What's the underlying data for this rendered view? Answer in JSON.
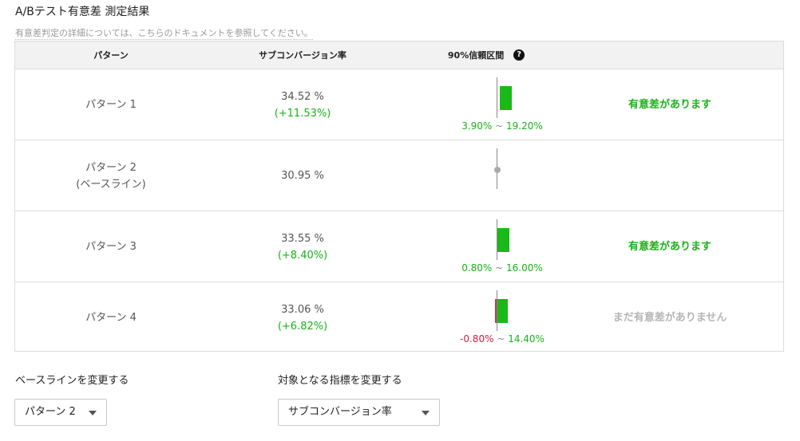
{
  "page": {
    "title": "A/Bテスト有意差 測定結果",
    "subtitle": "有意差判定の詳細については、こちらのドキュメントを参照してください。"
  },
  "table": {
    "headers": {
      "pattern": "パターン",
      "rate": "サブコンバージョン率",
      "ci": "90%信頼区間",
      "help_icon_glyph": "?"
    },
    "rows": [
      {
        "name": "パターン 1",
        "name_sub": "",
        "rate": "34.52 %",
        "lift": "(+11.53%)",
        "ci_low": "3.90%",
        "ci_sep": "~",
        "ci_high": "19.20%",
        "ci_low_value": 3.9,
        "ci_high_value": 19.2,
        "verdict": "有意差があります",
        "verdict_status": "significant"
      },
      {
        "name": "パターン 2",
        "name_sub": "(ベースライン)",
        "rate": "30.95 %",
        "lift": "",
        "ci_low": "",
        "ci_sep": "",
        "ci_high": "",
        "verdict": "",
        "verdict_status": "baseline"
      },
      {
        "name": "パターン 3",
        "name_sub": "",
        "rate": "33.55 %",
        "lift": "(+8.40%)",
        "ci_low": "0.80%",
        "ci_sep": "~",
        "ci_high": "16.00%",
        "ci_low_value": 0.8,
        "ci_high_value": 16.0,
        "verdict": "有意差があります",
        "verdict_status": "significant"
      },
      {
        "name": "パターン 4",
        "name_sub": "",
        "rate": "33.06 %",
        "lift": "(+6.82%)",
        "ci_low": "-0.80%",
        "ci_sep": "~",
        "ci_high": "14.40%",
        "ci_low_value": -0.8,
        "ci_high_value": 14.4,
        "verdict": "まだ有意差がありません",
        "verdict_status": "not_yet"
      }
    ]
  },
  "controls": {
    "baseline_label": "ベースラインを変更する",
    "baseline_value": "パターン 2",
    "metric_label": "対象となる指標を変更する",
    "metric_value": "サブコンバージョン率"
  },
  "colors": {
    "positive": "#17b317",
    "negative": "#d0203f",
    "muted": "#b5b5b5",
    "header_bg": "#f2f2f2",
    "border": "#dcdcdc"
  }
}
